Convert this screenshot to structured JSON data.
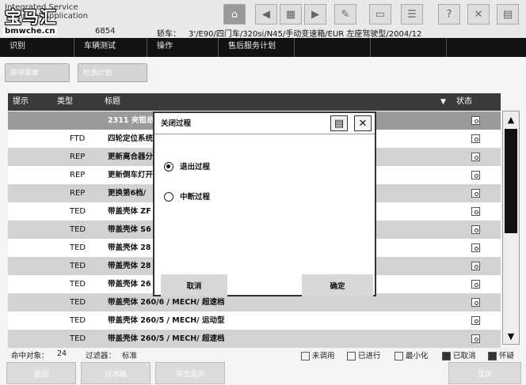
{
  "header": {
    "app_title_line1": "Integrated Service",
    "app_title_line2": "Technical Application",
    "watermark": "宝马汇",
    "watermark_sub": "bmwche.cn",
    "vehicle_no": "6854",
    "vehicle_label": "轿车：",
    "vehicle_info": "3'/E90/四门车/320si/N45/手动变速箱/EUR 左座驾驶型/2004/12",
    "toolbar": {
      "home": "⌂",
      "back": "◀",
      "print_view": "▦",
      "forward": "▶",
      "tools": "✎",
      "window": "▭",
      "list": "☰",
      "help": "?",
      "settings": "✕",
      "close": "▤"
    }
  },
  "menu": [
    "识别",
    "车辆测试",
    "操作",
    "售后服务计划",
    "",
    "",
    "",
    ""
  ],
  "tabs": [
    "命中菜单",
    "检测计划"
  ],
  "table": {
    "headers": {
      "hint": "提示",
      "type": "类型",
      "title": "标题",
      "status": "状态"
    },
    "rows": [
      {
        "type": "",
        "title": "2311 夹钳总成",
        "style": "sel"
      },
      {
        "type": "FTD",
        "title": "四轮定位系统",
        "style": "odd"
      },
      {
        "type": "REP",
        "title": "更新离合器分",
        "style": "even"
      },
      {
        "type": "REP",
        "title": "更新倒车灯开",
        "style": "odd"
      },
      {
        "type": "REP",
        "title": "更换第6档/",
        "style": "even"
      },
      {
        "type": "TED",
        "title": "带盖壳体 ZF",
        "style": "odd"
      },
      {
        "type": "TED",
        "title": "带盖壳体 S6",
        "style": "even"
      },
      {
        "type": "TED",
        "title": "带盖壳体 28",
        "style": "odd"
      },
      {
        "type": "TED",
        "title": "带盖壳体 28",
        "style": "even"
      },
      {
        "type": "TED",
        "title": "带盖壳体 26",
        "style": "odd"
      },
      {
        "type": "TED",
        "title": "带盖壳体 260/6 / MECH/ 超速档",
        "style": "even"
      },
      {
        "type": "TED",
        "title": "带盖壳体 260/5 / MECH/ 运动型",
        "style": "odd"
      },
      {
        "type": "TED",
        "title": "带盖壳体 260/5 / MECH/ 超速档",
        "style": "even"
      }
    ]
  },
  "status_bar": {
    "hits_label": "命中对象：",
    "hits_value": "24",
    "filter_label": "过滤器：",
    "filter_value": "标准",
    "legend": [
      "未调用",
      "已进行",
      "最小化",
      "已取消",
      "怀疑"
    ]
  },
  "bottom_buttons": [
    "返回",
    "过滤器",
    "完全显示",
    "显示"
  ],
  "dialog": {
    "title": "关闭过程",
    "options": [
      {
        "label": "退出过程",
        "selected": true
      },
      {
        "label": "中断过程",
        "selected": false
      }
    ],
    "cancel": "取消",
    "ok": "确定"
  }
}
